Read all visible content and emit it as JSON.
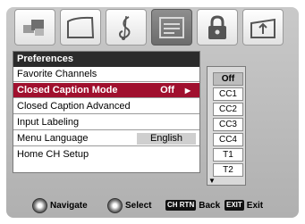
{
  "tabs": [
    {
      "icon": "picture-icon"
    },
    {
      "icon": "screen-icon"
    },
    {
      "icon": "audio-icon"
    },
    {
      "icon": "preferences-icon",
      "active": true
    },
    {
      "icon": "lock-icon"
    },
    {
      "icon": "setup-icon"
    }
  ],
  "preferences": {
    "title": "Preferences",
    "rows": [
      {
        "label": "Favorite Channels"
      },
      {
        "label": "Closed Caption Mode",
        "value": "Off",
        "arrow": "▶",
        "selected": true
      },
      {
        "label": "Closed Caption Advanced"
      },
      {
        "label": "Input Labeling"
      },
      {
        "label": "Menu Language",
        "value": "English"
      },
      {
        "label": "Home CH Setup"
      }
    ]
  },
  "caption_options": {
    "items": [
      "Off",
      "CC1",
      "CC2",
      "CC3",
      "CC4",
      "T1",
      "T2"
    ],
    "current": "Off",
    "scroll_arrow": "▼"
  },
  "nav": {
    "navigate": "Navigate",
    "select": "Select",
    "back_key": "CH RTN",
    "back": "Back",
    "exit_key": "EXIT",
    "exit": "Exit"
  }
}
